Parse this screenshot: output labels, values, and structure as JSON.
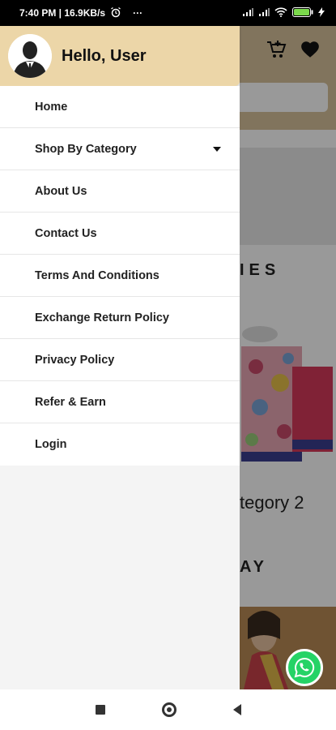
{
  "status_bar": {
    "time_speed": "7:40 PM | 16.9KB/s",
    "dots": "···",
    "battery": "",
    "icons": [
      "alarm-icon",
      "signal-icon",
      "signal-icon",
      "wifi-icon",
      "battery-icon",
      "charging-icon"
    ]
  },
  "drawer": {
    "greeting": "Hello, User",
    "avatar_icon": "user-avatar-icon",
    "items": [
      {
        "label": "Home"
      },
      {
        "label": "Shop By Category",
        "expandable": true
      },
      {
        "label": "About Us"
      },
      {
        "label": "Contact Us"
      },
      {
        "label": "Terms And Conditions"
      },
      {
        "label": "Exchange Return Policy"
      },
      {
        "label": "Privacy Policy"
      },
      {
        "label": "Refer & Earn"
      },
      {
        "label": "Login"
      }
    ]
  },
  "background_app": {
    "section_title_partial": "IES",
    "category_label_partial": "tegory 2",
    "sub_title_partial": "AY",
    "icons": [
      "cart-add-icon",
      "heart-icon",
      "whatsapp-icon"
    ],
    "colors": {
      "header": "#d8c29b",
      "drawer_header": "#ecd6a8",
      "whatsapp": "#25d366"
    }
  },
  "nav_bar": {
    "icons": [
      "recents-square-icon",
      "home-circle-icon",
      "back-triangle-icon"
    ]
  }
}
